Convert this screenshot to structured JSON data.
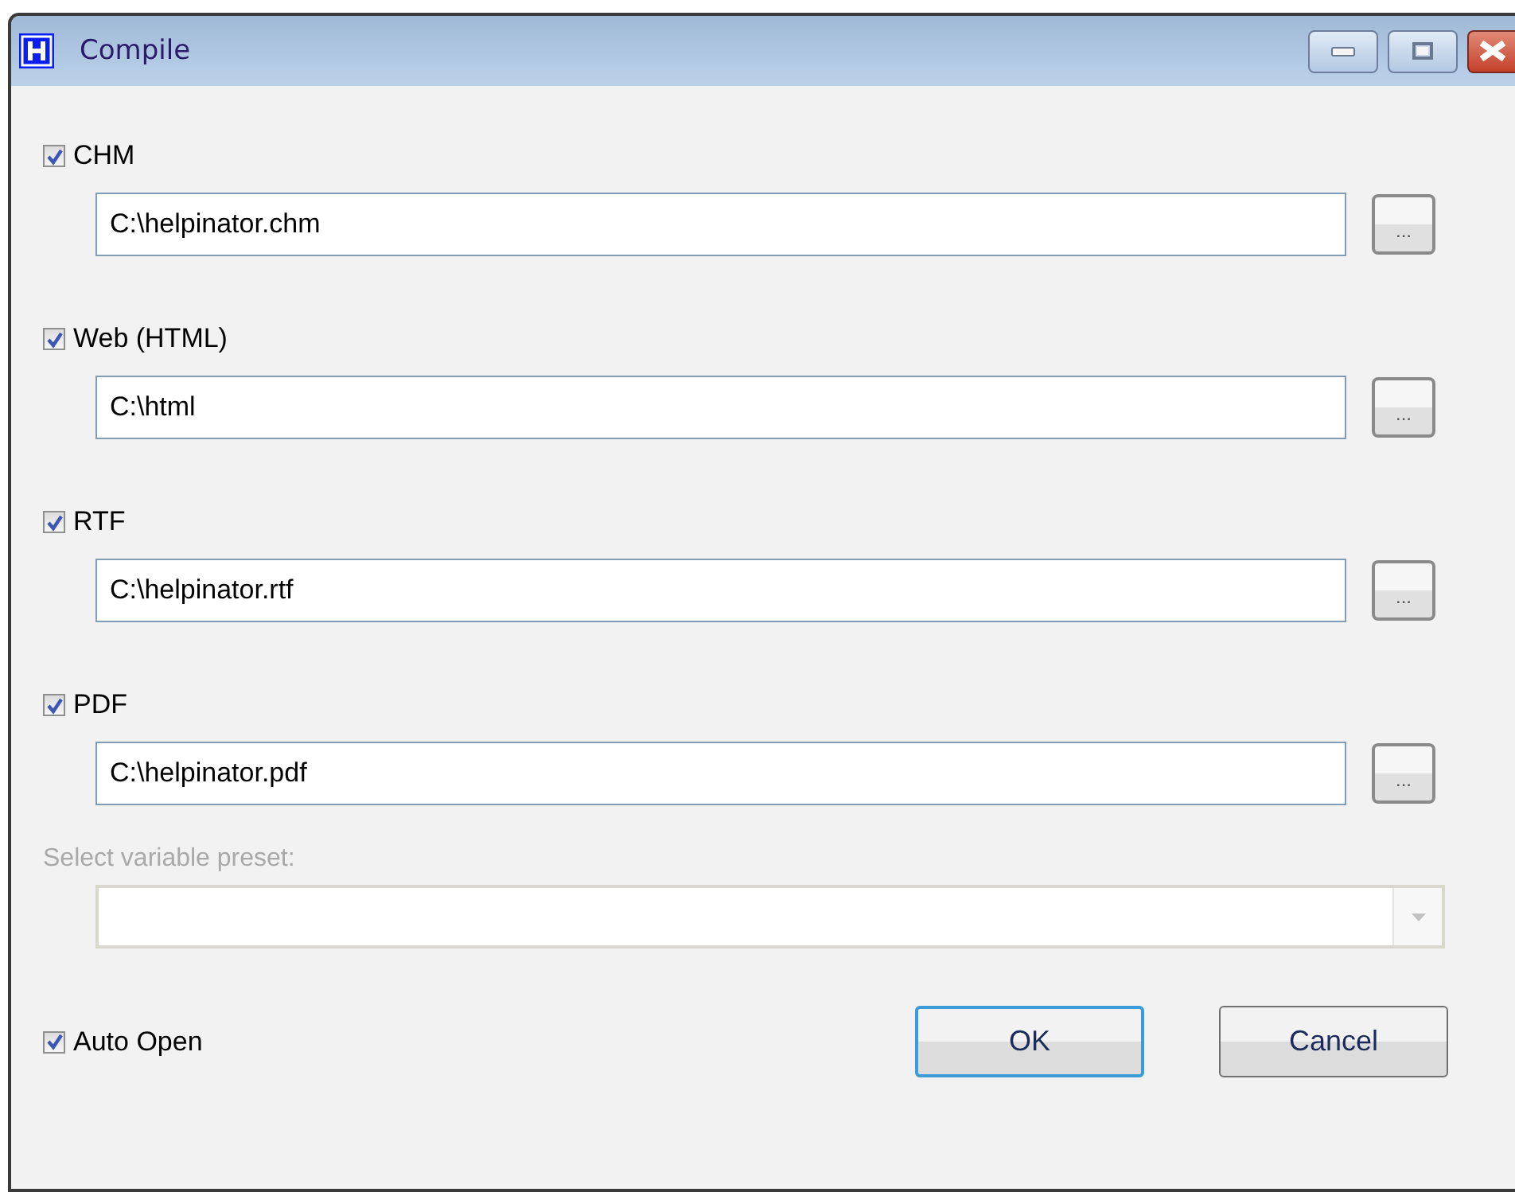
{
  "window": {
    "title": "Compile"
  },
  "outputs": [
    {
      "label": "CHM",
      "checked": true,
      "path": "C:\\helpinator.chm",
      "browse": "..."
    },
    {
      "label": "Web (HTML)",
      "checked": true,
      "path": "C:\\html",
      "browse": "..."
    },
    {
      "label": "RTF",
      "checked": true,
      "path": "C:\\helpinator.rtf",
      "browse": "..."
    },
    {
      "label": "PDF",
      "checked": true,
      "path": "C:\\helpinator.pdf",
      "browse": "..."
    }
  ],
  "preset": {
    "label": "Select variable preset:",
    "disabled": true
  },
  "auto_open": {
    "label": "Auto Open",
    "checked": true
  },
  "buttons": [
    {
      "label": "OK",
      "default": true
    },
    {
      "label": "Cancel",
      "default": false
    }
  ]
}
